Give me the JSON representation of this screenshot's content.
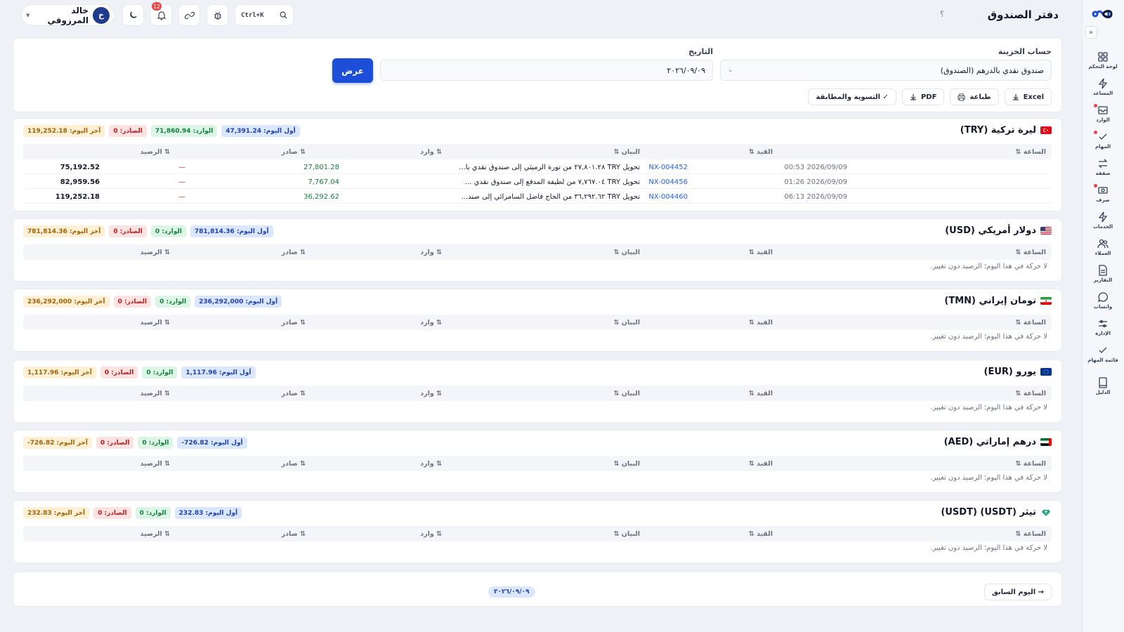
{
  "header": {
    "title": "دفتر الصندوق",
    "help": "؟",
    "search_shortcut": "Ctrl+K",
    "notifications_count": "12",
    "user_name": "خالد المرزوقي",
    "user_initial": "خ"
  },
  "sidebar": {
    "items": [
      {
        "label": "لوحة التحكم",
        "icon": "dashboard-icon"
      },
      {
        "label": "المساعد",
        "icon": "bolt-icon"
      },
      {
        "label": "الوارد",
        "icon": "inbox-icon"
      },
      {
        "label": "المهام",
        "icon": "check-icon"
      },
      {
        "label": "صفقة",
        "icon": "swap-icon"
      },
      {
        "label": "صرف",
        "icon": "exchange-icon"
      },
      {
        "label": "الخدمات",
        "icon": "bolt-icon"
      },
      {
        "label": "العملاء",
        "icon": "users-icon"
      },
      {
        "label": "التقارير",
        "icon": "report-icon"
      },
      {
        "label": "واتساب",
        "icon": "chat-icon"
      },
      {
        "label": "الإدارة",
        "icon": "sliders-icon"
      },
      {
        "label": "قائمة المهام",
        "icon": "checklist-icon"
      },
      {
        "label": "الدليل",
        "icon": "book-icon"
      }
    ]
  },
  "filters": {
    "account_label": "حساب الخزينة",
    "account_value": "صندوق نقدي بالدرهم (الصندوق)",
    "date_label": "التاريخ",
    "date_value": "٢٠٢٦/٠٩/٠٩",
    "show_button": "عرض",
    "actions": {
      "excel": "Excel",
      "print": "طباعة",
      "pdf": "PDF",
      "reconcile": "✓ التسوية والمطابقة"
    }
  },
  "table_headers": {
    "time": "الساعة ⇅",
    "ref": "القيد ⇅",
    "desc": "البيان ⇅",
    "in": "⇅ وارد",
    "out": "⇅ صادر",
    "balance": "⇅ الرصيد"
  },
  "empty_text": "لا حركة في هذا اليوم؛ الرصيد دون تغيير.",
  "currencies": [
    {
      "name": "ليرة تركية (TRY)",
      "flag": "tr",
      "open": "أول اليوم: 47,391.24",
      "in": "الوارد: 71,860.94",
      "out": "الصادر: 0",
      "close": "آخر اليوم: 119,252.18",
      "rows": [
        {
          "time": "2026/09/09 00:53",
          "ref": "NX-004452",
          "desc": "تحويل TRY ٢٧,٨٠١.٢٨ من نورة الرميثي إلى صندوق نقدي با...",
          "in": "27,801.28",
          "out": "—",
          "balance": "75,192.52"
        },
        {
          "time": "2026/09/09 01:26",
          "ref": "NX-004456",
          "desc": "تحويل TRY ٧,٧٦٧.٠٤ من لطيفة المدفع إلى صندوق نقدي ...",
          "in": "7,767.04",
          "out": "—",
          "balance": "82,959.56"
        },
        {
          "time": "2026/09/09 06:13",
          "ref": "NX-004460",
          "desc": "تحويل TRY ٣٦,٢٩٢.٦٢ من الحاج فاضل السامرائي إلى صند...",
          "in": "36,292.62",
          "out": "—",
          "balance": "119,252.18"
        }
      ]
    },
    {
      "name": "دولار أمريكي (USD)",
      "flag": "us",
      "open": "أول اليوم: 781,814.36",
      "in": "الوارد: 0",
      "out": "الصادر: 0",
      "close": "آخر اليوم: 781,814.36",
      "rows": []
    },
    {
      "name": "تومان إيراني (TMN)",
      "flag": "ir",
      "open": "أول اليوم: 236,292,000",
      "in": "الوارد: 0",
      "out": "الصادر: 0",
      "close": "آخر اليوم: 236,292,000",
      "rows": []
    },
    {
      "name": "يورو (EUR)",
      "flag": "eu",
      "open": "أول اليوم: 1,117.96",
      "in": "الوارد: 0",
      "out": "الصادر: 0",
      "close": "آخر اليوم: 1,117.96",
      "rows": []
    },
    {
      "name": "درهم إماراتي (AED)",
      "flag": "ae",
      "open": "أول اليوم: 726.82-",
      "in": "الوارد: 0",
      "out": "الصادر: 0",
      "close": "آخر اليوم: 726.82-",
      "rows": []
    },
    {
      "name": "تيثر (USDT) (USDT)",
      "flag": "usdt",
      "open": "أول اليوم: 232.83",
      "in": "الوارد: 0",
      "out": "الصادر: 0",
      "close": "آخر اليوم: 232.83",
      "rows": []
    }
  ],
  "pager": {
    "prev": "→ اليوم السابق",
    "current": "٢٠٢٦/٠٩/٠٩"
  },
  "colors": {
    "primary": "#1d4ed8",
    "in": "#15803d",
    "out": "#dc2626"
  }
}
